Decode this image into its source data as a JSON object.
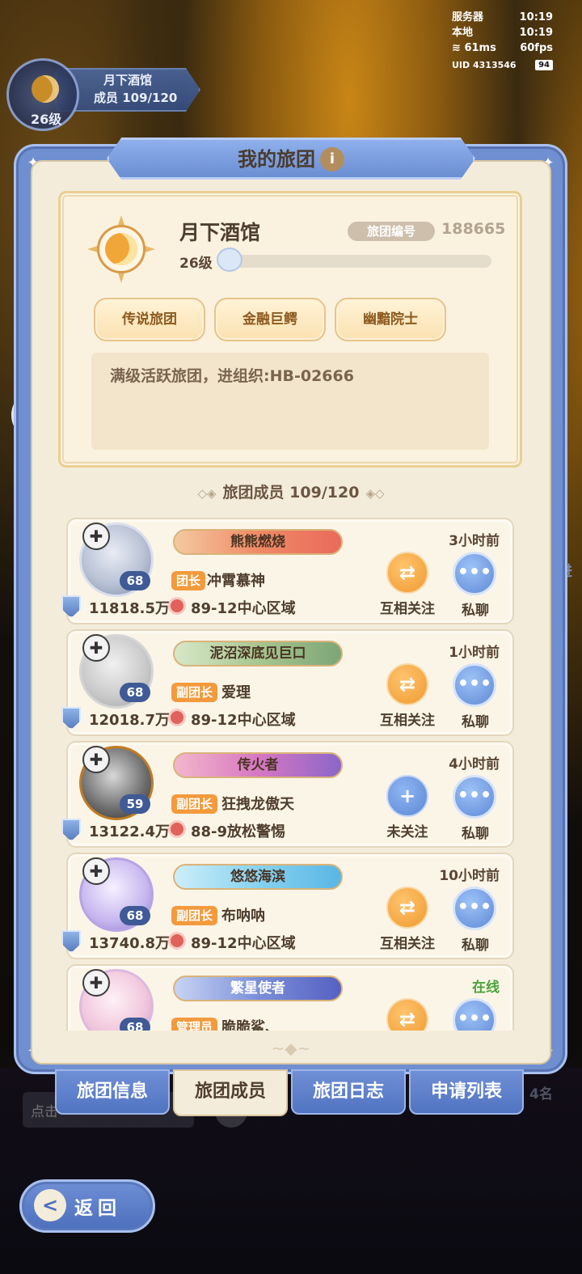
{
  "status": {
    "server_label": "服务器",
    "server_time": "10:19",
    "local_label": "本地",
    "local_time": "10:19",
    "ping": "61ms",
    "fps": "60fps",
    "uid": "UID 4313546",
    "battery": "94"
  },
  "guild_header": {
    "name": "月下酒馆",
    "members": "成员  109/120",
    "level": "26级"
  },
  "panel": {
    "title": "我的旅团",
    "info_icon": "i"
  },
  "guild": {
    "name": "月下酒馆",
    "id_label": "旅团编号",
    "id_value": "188665",
    "level": "26级",
    "level_progress": 0.02,
    "tags": [
      "传说旅团",
      "金融巨鳄",
      "幽黯院士"
    ],
    "motto": "满级活跃旅团，进组织:HB-02666"
  },
  "members_section": {
    "title": "旅团成员 109/120",
    "left_deco": "◇◈",
    "right_deco": "◈◇"
  },
  "members": [
    {
      "title": "熊熊燃烧",
      "role": "团长",
      "name": "冲霄慕神",
      "level": "68",
      "power": "11818.5万",
      "location": "89-12中心区域",
      "time": "3小时前",
      "follow_label": "互相关注",
      "follow_icon": "⇄",
      "chat_label": "私聊"
    },
    {
      "title": "泥沼深底见巨口",
      "role": "副团长",
      "name": "爱理",
      "level": "68",
      "power": "12018.7万",
      "location": "89-12中心区域",
      "time": "1小时前",
      "follow_label": "互相关注",
      "follow_icon": "⇄",
      "chat_label": "私聊"
    },
    {
      "title": "传火者",
      "role": "副团长",
      "name": "狂拽龙傲天",
      "level": "59",
      "power": "13122.4万",
      "location": "88-9放松警惕",
      "time": "4小时前",
      "follow_label": "未关注",
      "follow_icon": "+",
      "chat_label": "私聊"
    },
    {
      "title": "悠悠海滨",
      "role": "副团长",
      "name": "布呐呐",
      "level": "68",
      "power": "13740.8万",
      "location": "89-12中心区域",
      "time": "10小时前",
      "follow_label": "互相关注",
      "follow_icon": "⇄",
      "chat_label": "私聊"
    },
    {
      "title": "繁星使者",
      "role": "管理员",
      "name": "脆脆鲨、",
      "level": "68",
      "power": "",
      "location": "",
      "time": "在线",
      "follow_label": "",
      "follow_icon": "⇄",
      "chat_label": ""
    }
  ],
  "tabs": [
    "旅团信息",
    "旅团成员",
    "旅团日志",
    "申请列表"
  ],
  "active_tab": "旅团成员",
  "hint_text": "点击",
  "right_hint": "4名",
  "edge_text": "进",
  "back_label": "返回",
  "back_icon": "<"
}
